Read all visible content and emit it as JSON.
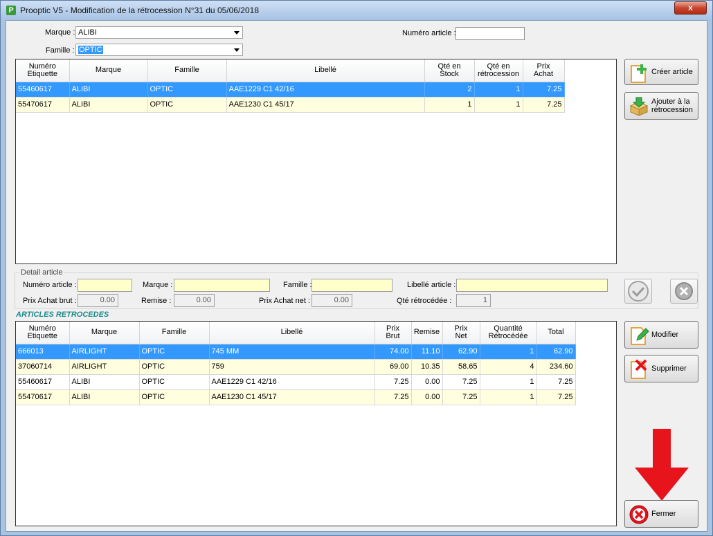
{
  "window": {
    "title": "Prooptic V5 - Modification de la rétrocession N°31 du 05/06/2018",
    "app_icon": "P",
    "close_glyph": "x"
  },
  "filters": {
    "marque_label": "Marque :",
    "marque_value": "ALIBI",
    "famille_label": "Famille :",
    "famille_value": "OPTIC",
    "numero_article_label": "Numéro article :",
    "numero_article_value": ""
  },
  "stock_grid": {
    "columns": [
      "Numéro\nEtiquette",
      "Marque",
      "Famille",
      "Libellé",
      "Qté en\nStock",
      "Qté en\nrétrocession",
      "Prix\nAchat"
    ],
    "rows": [
      [
        "55460617",
        "ALIBI",
        "OPTIC",
        "AAE1229 C1 42/16",
        "2",
        "1",
        "7.25"
      ],
      [
        "55470617",
        "ALIBI",
        "OPTIC",
        "AAE1230 C1 45/17",
        "1",
        "1",
        "7.25"
      ]
    ]
  },
  "buttons": {
    "creer_article": "Créer article",
    "ajouter_retro": "Ajouter à la\nrétrocession",
    "modifier": "Modifier",
    "supprimer": "Supprimer",
    "fermer": "Fermer"
  },
  "detail": {
    "legend": "Detail article",
    "numero_label": "Numéro article :",
    "marque_label": "Marque :",
    "famille_label": "Famille :",
    "libelle_label": "Libellé article :",
    "prix_brut_label": "Prix Achat brut :",
    "prix_brut_value": "0.00",
    "remise_label": "Remise :",
    "remise_value": "0.00",
    "prix_net_label": "Prix Achat net :",
    "prix_net_value": "0.00",
    "qte_label": "Qté rétrocédée :",
    "qte_value": "1"
  },
  "retro": {
    "section_title": "ARTICLES RETROCEDES",
    "columns": [
      "Numéro\nEtiquette",
      "Marque",
      "Famille",
      "Libellé",
      "Prix\nBrut",
      "Remise",
      "Prix\nNet",
      "Quantité\nRétrocédée",
      "Total"
    ],
    "rows": [
      [
        "666013",
        "AIRLIGHT",
        "OPTIC",
        "745 MM",
        "74.00",
        "11.10",
        "62.90",
        "1",
        "62.90"
      ],
      [
        "37060714",
        "AIRLIGHT",
        "OPTIC",
        "759",
        "69.00",
        "10.35",
        "58.65",
        "4",
        "234.60"
      ],
      [
        "55460617",
        "ALIBI",
        "OPTIC",
        "AAE1229 C1 42/16",
        "7.25",
        "0.00",
        "7.25",
        "1",
        "7.25"
      ],
      [
        "55470617",
        "ALIBI",
        "OPTIC",
        "AAE1230 C1 45/17",
        "7.25",
        "0.00",
        "7.25",
        "1",
        "7.25"
      ]
    ]
  },
  "colors": {
    "selection": "#3399ff",
    "alt_row": "#ffffe0",
    "detail_field": "#ffffcc",
    "section_title": "#1f8a8a",
    "arrow": "#e8141c"
  },
  "icons": {
    "creer": "document-plus-icon",
    "ajouter": "box-download-icon",
    "valider": "checkmark-icon",
    "annuler": "cancel-x-icon",
    "modifier": "document-pencil-icon",
    "supprimer": "document-x-icon",
    "fermer": "close-circle-icon",
    "arrow": "red-down-arrow-icon"
  }
}
